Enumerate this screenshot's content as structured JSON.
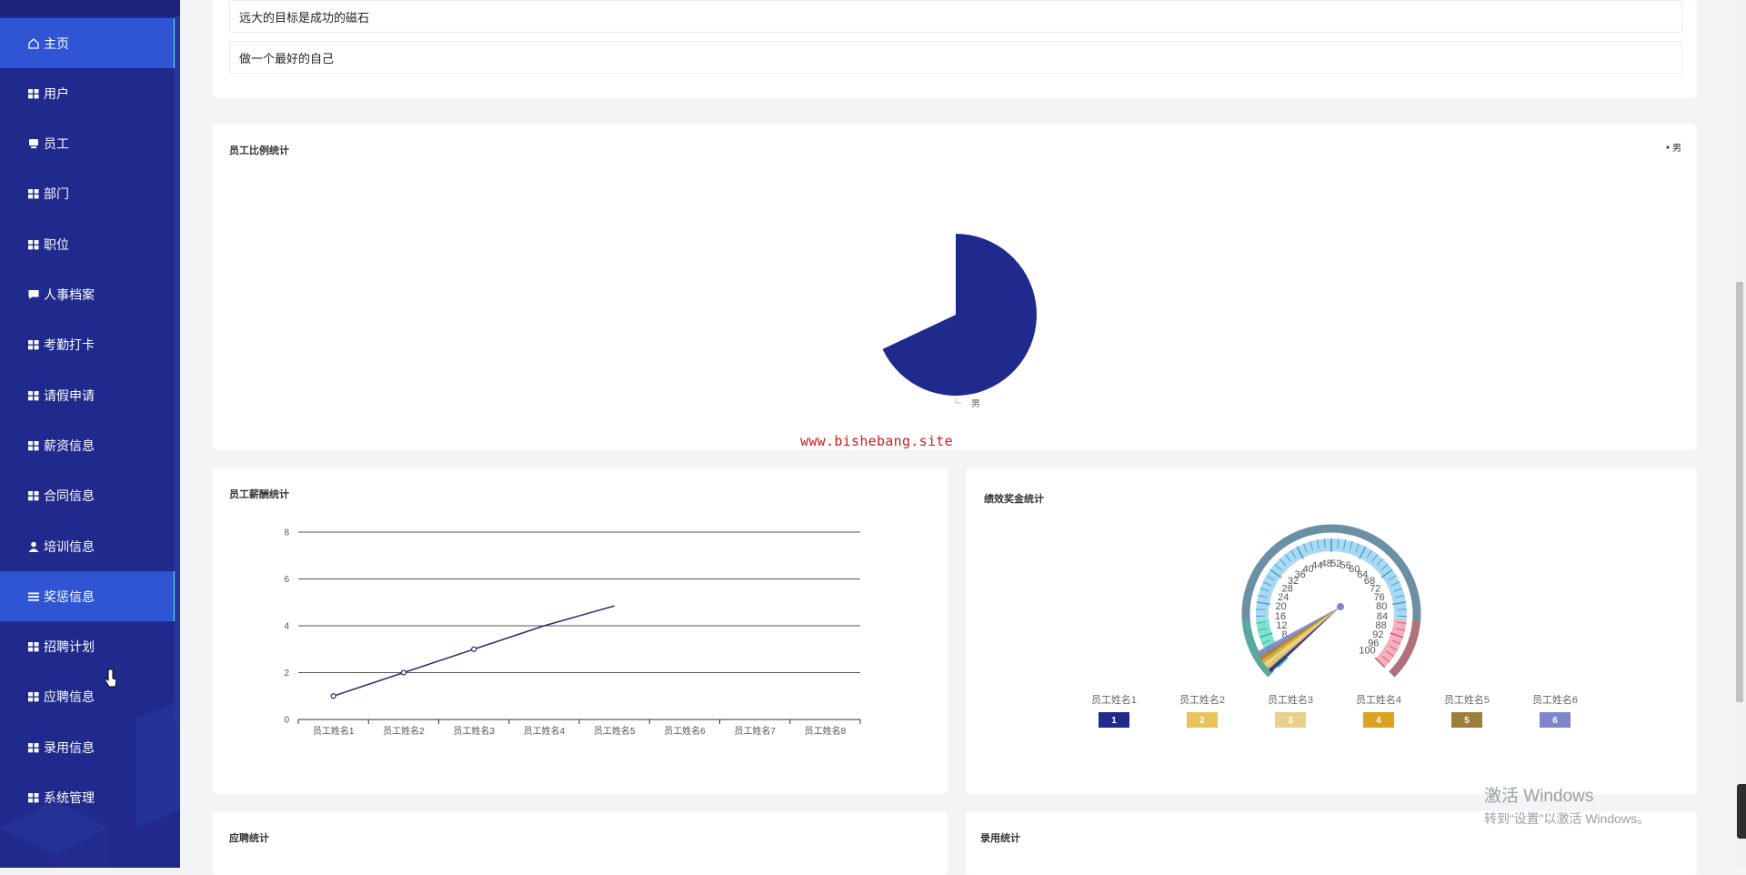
{
  "sidebar": {
    "items": [
      {
        "label": "主页",
        "icon": "home-icon",
        "active": true
      },
      {
        "label": "用户",
        "icon": "grid-icon"
      },
      {
        "label": "员工",
        "icon": "monitor-icon"
      },
      {
        "label": "部门",
        "icon": "grid-icon"
      },
      {
        "label": "职位",
        "icon": "grid-icon"
      },
      {
        "label": "人事档案",
        "icon": "chat-icon"
      },
      {
        "label": "考勤打卡",
        "icon": "grid-icon"
      },
      {
        "label": "请假申请",
        "icon": "grid-icon"
      },
      {
        "label": "薪资信息",
        "icon": "grid-icon"
      },
      {
        "label": "合同信息",
        "icon": "grid-icon"
      },
      {
        "label": "培训信息",
        "icon": "user-icon"
      },
      {
        "label": "奖惩信息",
        "icon": "list-icon",
        "hovered": true
      },
      {
        "label": "招聘计划",
        "icon": "grid-icon"
      },
      {
        "label": "应聘信息",
        "icon": "grid-icon"
      },
      {
        "label": "录用信息",
        "icon": "grid-icon"
      },
      {
        "label": "系统管理",
        "icon": "grid-icon"
      }
    ]
  },
  "mottos": [
    "远大的目标是成功的磁石",
    "做一个最好的自己"
  ],
  "panels": {
    "ratio_title": "员工比例统计",
    "salary_title": "员工薪酬统计",
    "bonus_title": "绩效奖金统计",
    "applicant_title": "应聘统计",
    "hire_title": "录用统计"
  },
  "watermark": "www.bishebang.site",
  "os_notice": {
    "title": "激活 Windows",
    "subtitle": "转到“设置”以激活 Windows。"
  },
  "chart_data": [
    {
      "type": "pie",
      "title": "员工比例统计",
      "legend": [
        "男"
      ],
      "legend_position": "top-right",
      "slices": [
        {
          "name": "男",
          "value": 1,
          "color": "#1f2a8c"
        }
      ],
      "label": "男"
    },
    {
      "type": "line",
      "title": "员工薪酬统计",
      "categories": [
        "员工姓名1",
        "员工姓名2",
        "员工姓名3",
        "员工姓名4",
        "员工姓名5",
        "员工姓名6",
        "员工姓名7",
        "员工姓名8"
      ],
      "series": [
        {
          "values": [
            1,
            2,
            3,
            4,
            4.85,
            null,
            null,
            null
          ],
          "color": "#2a2f6e"
        }
      ],
      "ylim": [
        0,
        8
      ],
      "yticks": [
        0,
        2,
        4,
        6,
        8
      ],
      "grid": true
    },
    {
      "type": "gauge",
      "title": "绩效奖金统计",
      "min": 0,
      "max": 100,
      "tick_labels": [
        8,
        12,
        16,
        20,
        24,
        28,
        32,
        36,
        40,
        44,
        48,
        52,
        56,
        60,
        64,
        68,
        72,
        76,
        80,
        84,
        88,
        92,
        96,
        100
      ],
      "pointer_values": [
        1,
        2,
        3,
        4,
        5,
        6
      ],
      "legend": [
        {
          "name": "员工姓名1",
          "value": "1",
          "color": "#1f2a8c"
        },
        {
          "name": "员工姓名2",
          "value": "2",
          "color": "#e8c35a"
        },
        {
          "name": "员工姓名3",
          "value": "3",
          "color": "#ead08c"
        },
        {
          "name": "员工姓名4",
          "value": "4",
          "color": "#d9a520"
        },
        {
          "name": "员工姓名5",
          "value": "5",
          "color": "#9c7d3d"
        },
        {
          "name": "员工姓名6",
          "value": "6",
          "color": "#7c86c8"
        }
      ]
    }
  ]
}
